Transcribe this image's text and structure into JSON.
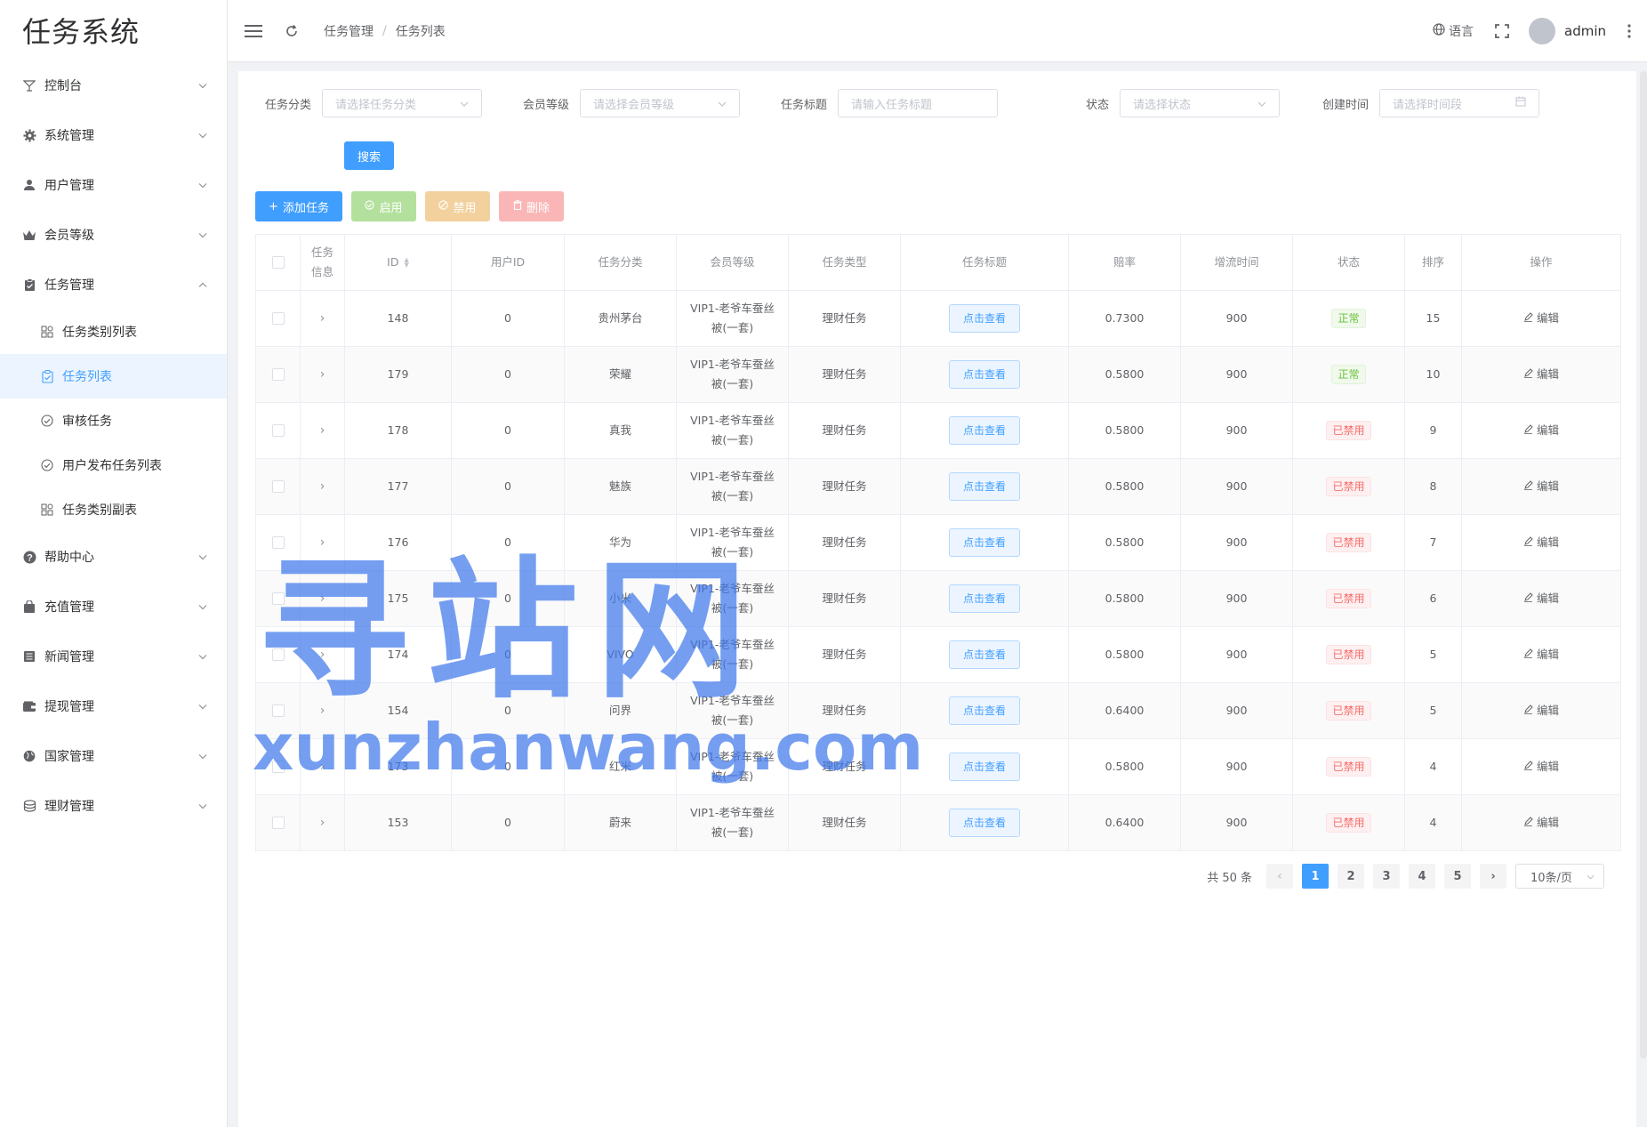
{
  "app": {
    "title": "任务系统"
  },
  "sidebar": {
    "items": [
      {
        "label": "控制台",
        "icon": "cocktail-icon",
        "expanded": false
      },
      {
        "label": "系统管理",
        "icon": "gear-icon",
        "expanded": false
      },
      {
        "label": "用户管理",
        "icon": "user-icon",
        "expanded": false
      },
      {
        "label": "会员等级",
        "icon": "crown-icon",
        "expanded": false
      },
      {
        "label": "任务管理",
        "icon": "clipboard-icon",
        "expanded": true,
        "children": [
          {
            "label": "任务类别列表",
            "icon": "grid-icon"
          },
          {
            "label": "任务列表",
            "icon": "clipboard-check-icon",
            "active": true
          },
          {
            "label": "审核任务",
            "icon": "circle-check-icon"
          },
          {
            "label": "用户发布任务列表",
            "icon": "circle-check-icon"
          },
          {
            "label": "任务类别副表",
            "icon": "grid-icon"
          }
        ]
      },
      {
        "label": "帮助中心",
        "icon": "question-icon",
        "expanded": false
      },
      {
        "label": "充值管理",
        "icon": "bag-icon",
        "expanded": false
      },
      {
        "label": "新闻管理",
        "icon": "news-icon",
        "expanded": false
      },
      {
        "label": "提现管理",
        "icon": "wallet-icon",
        "expanded": false
      },
      {
        "label": "国家管理",
        "icon": "globe-icon",
        "expanded": false
      },
      {
        "label": "理财管理",
        "icon": "coins-icon",
        "expanded": false
      }
    ]
  },
  "header": {
    "breadcrumb": [
      "任务管理",
      "任务列表"
    ],
    "language_label": "语言",
    "username": "admin"
  },
  "filters": {
    "category": {
      "label": "任务分类",
      "placeholder": "请选择任务分类"
    },
    "level": {
      "label": "会员等级",
      "placeholder": "请选择会员等级"
    },
    "title": {
      "label": "任务标题",
      "placeholder": "请输入任务标题"
    },
    "status": {
      "label": "状态",
      "placeholder": "请选择状态"
    },
    "created": {
      "label": "创建时间",
      "placeholder": "请选择时间段"
    },
    "search_label": "搜索"
  },
  "toolbar": {
    "add_label": "添加任务",
    "enable_label": "启用",
    "disable_label": "禁用",
    "delete_label": "删除"
  },
  "table": {
    "columns": {
      "info": "任务信息",
      "id": "ID",
      "user_id": "用户ID",
      "category": "任务分类",
      "level": "会员等级",
      "type": "任务类型",
      "title": "任务标题",
      "rate": "赔率",
      "time": "增流时间",
      "status": "状态",
      "sort": "排序",
      "ops": "操作"
    },
    "view_label": "点击查看",
    "edit_label": "编辑",
    "rows": [
      {
        "id": "148",
        "user_id": "0",
        "category": "贵州茅台",
        "level": "VIP1-老爷车蚕丝被(一套)",
        "type": "理财任务",
        "rate": "0.7300",
        "time": "900",
        "status": "正常",
        "status_ok": true,
        "sort": "15"
      },
      {
        "id": "179",
        "user_id": "0",
        "category": "荣耀",
        "level": "VIP1-老爷车蚕丝被(一套)",
        "type": "理财任务",
        "rate": "0.5800",
        "time": "900",
        "status": "正常",
        "status_ok": true,
        "sort": "10"
      },
      {
        "id": "178",
        "user_id": "0",
        "category": "真我",
        "level": "VIP1-老爷车蚕丝被(一套)",
        "type": "理财任务",
        "rate": "0.5800",
        "time": "900",
        "status": "已禁用",
        "status_ok": false,
        "sort": "9"
      },
      {
        "id": "177",
        "user_id": "0",
        "category": "魅族",
        "level": "VIP1-老爷车蚕丝被(一套)",
        "type": "理财任务",
        "rate": "0.5800",
        "time": "900",
        "status": "已禁用",
        "status_ok": false,
        "sort": "8"
      },
      {
        "id": "176",
        "user_id": "0",
        "category": "华为",
        "level": "VIP1-老爷车蚕丝被(一套)",
        "type": "理财任务",
        "rate": "0.5800",
        "time": "900",
        "status": "已禁用",
        "status_ok": false,
        "sort": "7"
      },
      {
        "id": "175",
        "user_id": "0",
        "category": "小米",
        "level": "VIP1-老爷车蚕丝被(一套)",
        "type": "理财任务",
        "rate": "0.5800",
        "time": "900",
        "status": "已禁用",
        "status_ok": false,
        "sort": "6"
      },
      {
        "id": "174",
        "user_id": "0",
        "category": "VIVO",
        "level": "VIP1-老爷车蚕丝被(一套)",
        "type": "理财任务",
        "rate": "0.5800",
        "time": "900",
        "status": "已禁用",
        "status_ok": false,
        "sort": "5"
      },
      {
        "id": "154",
        "user_id": "0",
        "category": "问界",
        "level": "VIP1-老爷车蚕丝被(一套)",
        "type": "理财任务",
        "rate": "0.6400",
        "time": "900",
        "status": "已禁用",
        "status_ok": false,
        "sort": "5"
      },
      {
        "id": "173",
        "user_id": "0",
        "category": "红米",
        "level": "VIP1-老爷车蚕丝被(一套)",
        "type": "理财任务",
        "rate": "0.5800",
        "time": "900",
        "status": "已禁用",
        "status_ok": false,
        "sort": "4"
      },
      {
        "id": "153",
        "user_id": "0",
        "category": "蔚来",
        "level": "VIP1-老爷车蚕丝被(一套)",
        "type": "理财任务",
        "rate": "0.6400",
        "time": "900",
        "status": "已禁用",
        "status_ok": false,
        "sort": "4"
      }
    ]
  },
  "pagination": {
    "total_label": "共 50 条",
    "pages": [
      "1",
      "2",
      "3",
      "4",
      "5"
    ],
    "current": "1",
    "page_size_label": "10条/页"
  },
  "watermark": {
    "cn": "寻站网",
    "en": "xunzhanwang.com"
  },
  "colors": {
    "primary": "#409eff",
    "success": "#67c23a",
    "danger": "#f56c6c"
  }
}
